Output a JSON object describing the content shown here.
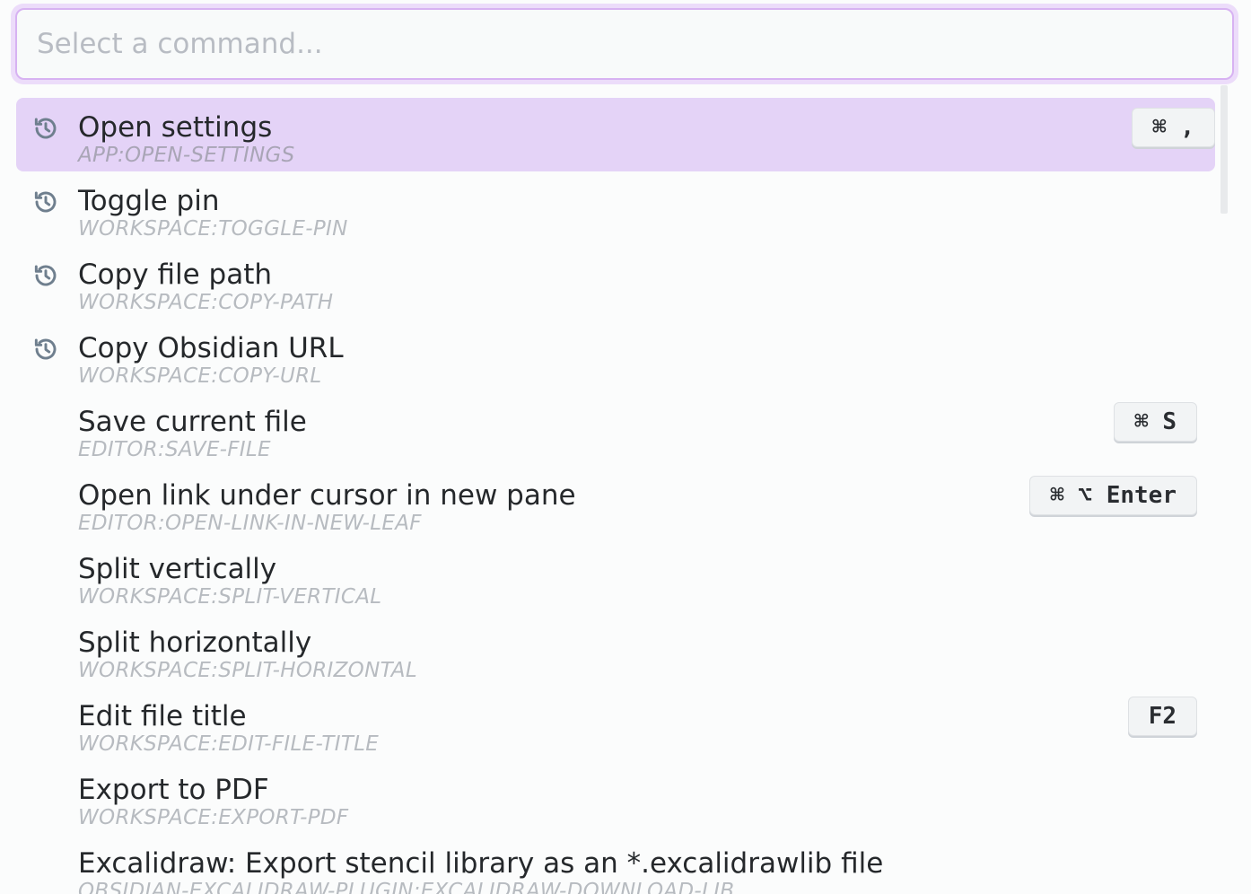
{
  "search": {
    "placeholder": "Select a command...",
    "value": ""
  },
  "commands": [
    {
      "title": "Open settings",
      "id": "APP:OPEN-SETTINGS",
      "recent": true,
      "hotkey": "⌘ ,",
      "selected": true
    },
    {
      "title": "Toggle pin",
      "id": "WORKSPACE:TOGGLE-PIN",
      "recent": true,
      "hotkey": ""
    },
    {
      "title": "Copy file path",
      "id": "WORKSPACE:COPY-PATH",
      "recent": true,
      "hotkey": ""
    },
    {
      "title": "Copy Obsidian URL",
      "id": "WORKSPACE:COPY-URL",
      "recent": true,
      "hotkey": ""
    },
    {
      "title": "Save current file",
      "id": "EDITOR:SAVE-FILE",
      "recent": false,
      "hotkey": "⌘ S"
    },
    {
      "title": "Open link under cursor in new pane",
      "id": "EDITOR:OPEN-LINK-IN-NEW-LEAF",
      "recent": false,
      "hotkey": "⌘ ⌥ Enter"
    },
    {
      "title": "Split vertically",
      "id": "WORKSPACE:SPLIT-VERTICAL",
      "recent": false,
      "hotkey": ""
    },
    {
      "title": "Split horizontally",
      "id": "WORKSPACE:SPLIT-HORIZONTAL",
      "recent": false,
      "hotkey": ""
    },
    {
      "title": "Edit file title",
      "id": "WORKSPACE:EDIT-FILE-TITLE",
      "recent": false,
      "hotkey": "F2"
    },
    {
      "title": "Export to PDF",
      "id": "WORKSPACE:EXPORT-PDF",
      "recent": false,
      "hotkey": ""
    },
    {
      "title": "Excalidraw: Export stencil library as an *.excalidrawlib file",
      "id": "OBSIDIAN-EXCALIDRAW-PLUGIN:EXCALIDRAW-DOWNLOAD-LIB",
      "recent": false,
      "hotkey": ""
    }
  ],
  "icons": {
    "recent": "history-icon"
  },
  "colors": {
    "accent": "#d7b2f2",
    "selected_bg": "#e4d3f7",
    "icon": "#6f7f8e"
  }
}
